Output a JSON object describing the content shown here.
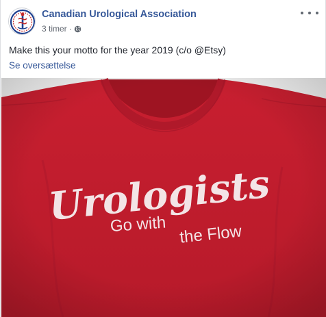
{
  "post": {
    "page_name": "Canadian Urological Association",
    "time": "3 timer",
    "separator": "·",
    "message": "Make this your motto for the year 2019 (c/o @Etsy)",
    "translate_link": "Se oversættelse"
  },
  "shirt": {
    "line1": "Urologists",
    "line2": "Go with",
    "line3": "the Flow"
  },
  "colors": {
    "link": "#365899",
    "shirt": "#c1202f",
    "print": "#f3e4e6"
  },
  "icons": {
    "avatar": "cua-logo-icon",
    "privacy": "globe-icon",
    "menu": "more-options-icon"
  }
}
